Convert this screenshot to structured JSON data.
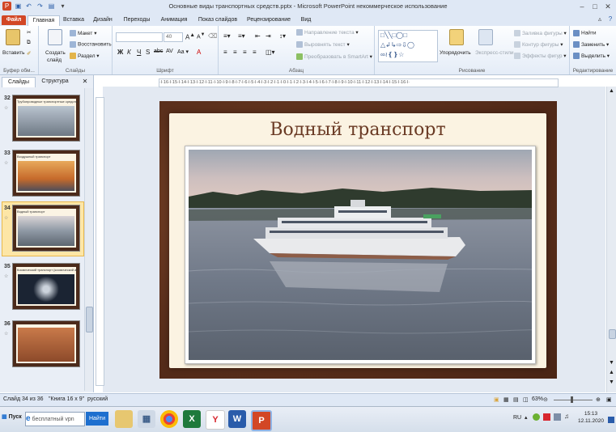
{
  "window": {
    "title": "Основные виды транспортных средств.pptx - Microsoft PowerPoint некоммерческое использование"
  },
  "tabs": [
    {
      "label": "Файл"
    },
    {
      "label": "Главная"
    },
    {
      "label": "Вставка"
    },
    {
      "label": "Дизайн"
    },
    {
      "label": "Переходы"
    },
    {
      "label": "Анимация"
    },
    {
      "label": "Показ слайдов"
    },
    {
      "label": "Рецензирование"
    },
    {
      "label": "Вид"
    }
  ],
  "ribbon": {
    "clipboard": {
      "paste": "Вставить",
      "label": "Буфер обм..."
    },
    "slides": {
      "new_slide_line1": "Создать",
      "new_slide_line2": "слайд",
      "layout": "Макет",
      "reset": "Восстановить",
      "section": "Раздел",
      "label": "Слайды"
    },
    "font": {
      "size": "40",
      "label": "Шрифт"
    },
    "paragraph": {
      "text_direction": "Направление текста",
      "align_text": "Выровнять текст",
      "smartart": "Преобразовать в SmartArt",
      "label": "Абзац"
    },
    "drawing": {
      "arrange": "Упорядочить",
      "quick_styles": "Экспресс-стили",
      "fill": "Заливка фигуры",
      "outline": "Контур фигуры",
      "effects": "Эффекты фигур",
      "label": "Рисование"
    },
    "editing": {
      "find": "Найти",
      "replace": "Заменить",
      "select": "Выделить",
      "label": "Редактирование"
    }
  },
  "left_pane": {
    "tabs": [
      "Слайды",
      "Структура"
    ],
    "thumbnails": [
      {
        "num": "32",
        "title": "Трубопроводные транспортные средства"
      },
      {
        "num": "33",
        "title": "Воздушный транспорт"
      },
      {
        "num": "34",
        "title": "Водный транспорт"
      },
      {
        "num": "35",
        "title": "Космический транспорт (космический аппарат)"
      },
      {
        "num": "36",
        "title": ""
      }
    ]
  },
  "ruler": {
    "text": "·l·16·l·15·l·14·l·13·l·12·l·11·l·10·l·9·l·8·l·7·l·6·l·5·l·4·l·3·l·2·l·1·l·0·l·1·l·2·l·3·l·4·l·5·l·6·l·7·l·8·l·9·l·10·l·11·l·12·l·13·l·14·l·15·l·16·l·"
  },
  "slide": {
    "title": "Водный транспорт"
  },
  "status": {
    "slide_of": "Слайд 34 из 36",
    "theme": "\"Книга 16 x 9\"",
    "language": "русский",
    "zoom": "63%"
  },
  "taskbar": {
    "start": "Пуск",
    "search": "бесплатный vpn",
    "search_button": "Найти",
    "lang": "RU",
    "time": "15:13",
    "date": "12.11.2020"
  }
}
